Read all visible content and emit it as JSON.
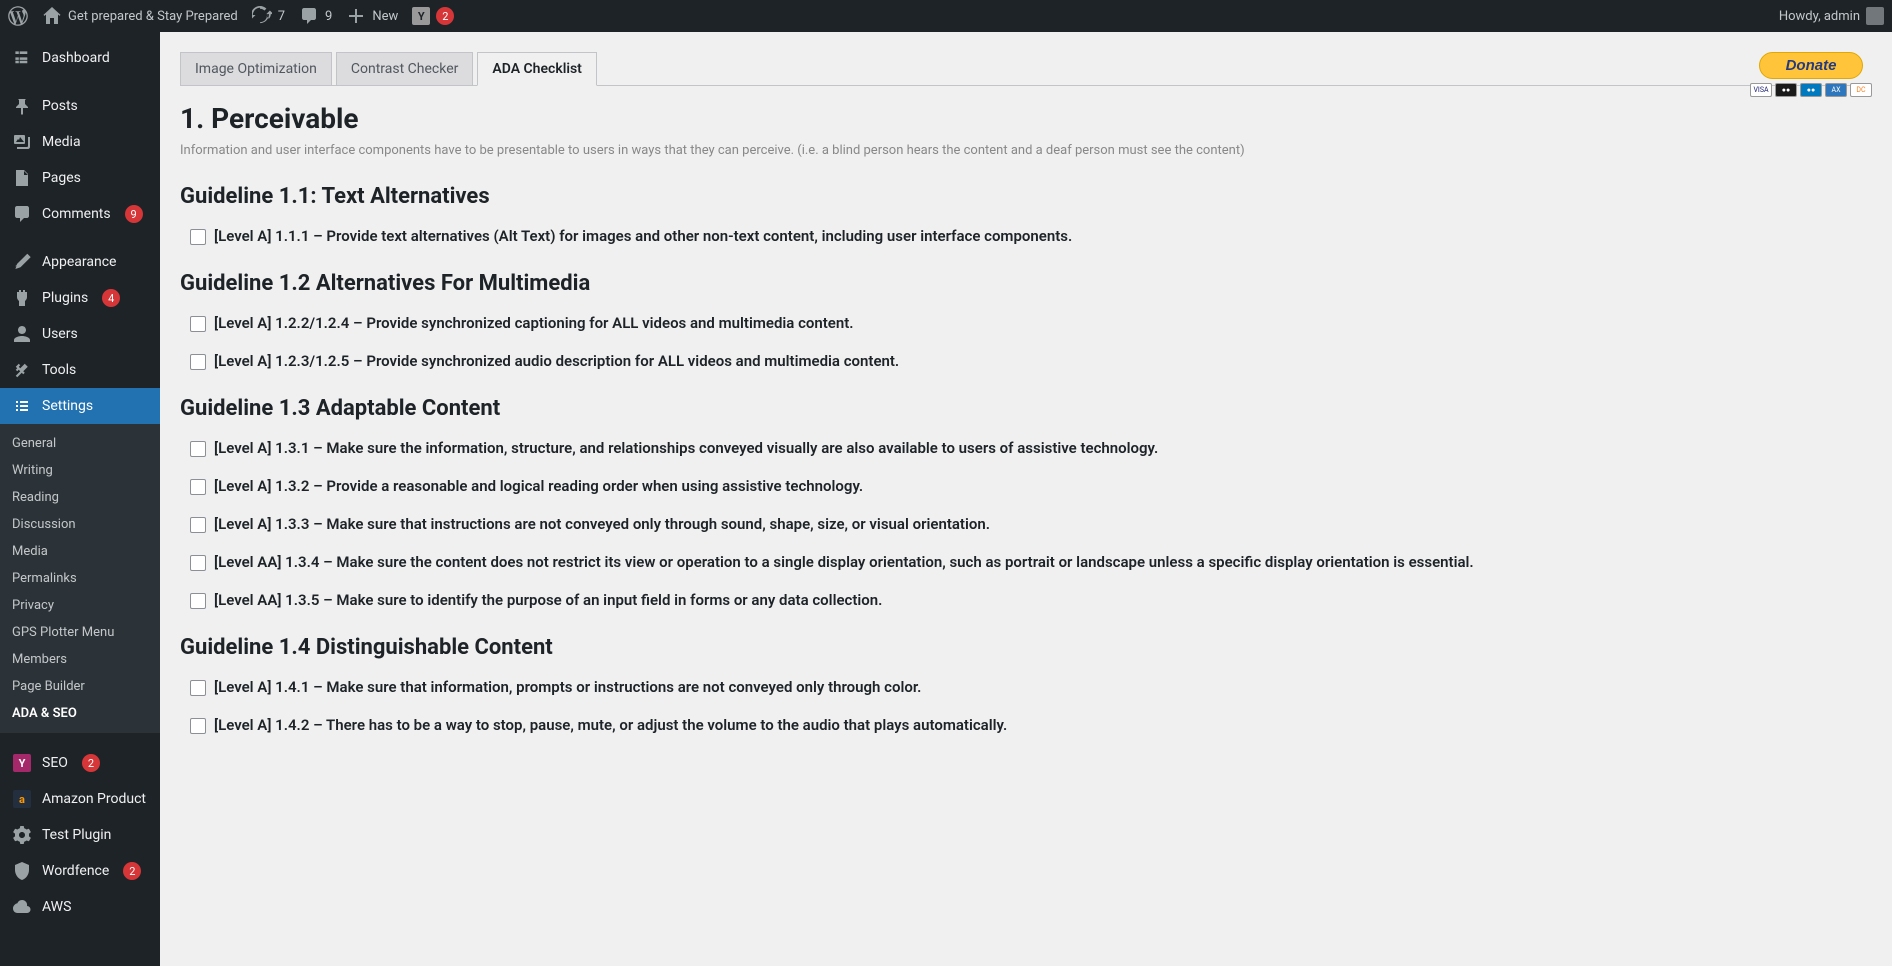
{
  "adminbar": {
    "site_name": "Get prepared & Stay Prepared",
    "updates": "7",
    "comments": "9",
    "new_label": "New",
    "yoast_badge": "2",
    "howdy": "Howdy, admin"
  },
  "sidebar": {
    "items": [
      {
        "label": "Dashboard",
        "icon": "dashboard"
      },
      {
        "label": "Posts",
        "icon": "pin"
      },
      {
        "label": "Media",
        "icon": "media"
      },
      {
        "label": "Pages",
        "icon": "page"
      },
      {
        "label": "Comments",
        "icon": "comment",
        "badge": "9"
      },
      {
        "label": "Appearance",
        "icon": "brush"
      },
      {
        "label": "Plugins",
        "icon": "plugin",
        "badge": "4"
      },
      {
        "label": "Users",
        "icon": "user"
      },
      {
        "label": "Tools",
        "icon": "tools"
      },
      {
        "label": "Settings",
        "icon": "settings",
        "current": true
      },
      {
        "label": "SEO",
        "icon": "yoast",
        "badge": "2"
      },
      {
        "label": "Amazon Product",
        "icon": "amazon"
      },
      {
        "label": "Test Plugin",
        "icon": "gear"
      },
      {
        "label": "Wordfence",
        "icon": "shield",
        "badge": "2"
      },
      {
        "label": "AWS",
        "icon": "cloud"
      }
    ],
    "submenu": [
      "General",
      "Writing",
      "Reading",
      "Discussion",
      "Media",
      "Permalinks",
      "Privacy",
      "GPS Plotter Menu",
      "Members",
      "Page Builder",
      "ADA & SEO"
    ],
    "submenu_current": "ADA & SEO"
  },
  "tabs": [
    "Image Optimization",
    "Contrast Checker",
    "ADA Checklist"
  ],
  "active_tab": "ADA Checklist",
  "donate": {
    "label": "Donate"
  },
  "content": {
    "h1": "1. Perceivable",
    "desc": "Information and user interface components have to be presentable to users in ways that they can perceive. (i.e. a blind person hears the content and a deaf person must see the content)",
    "sections": [
      {
        "title": "Guideline 1.1: Text Alternatives",
        "items": [
          "[Level A] 1.1.1 – Provide text alternatives (Alt Text) for images and other non-text content, including user interface components."
        ]
      },
      {
        "title": "Guideline 1.2 Alternatives For Multimedia",
        "items": [
          "[Level A] 1.2.2/1.2.4 – Provide synchronized captioning for ALL videos and multimedia content.",
          "[Level A] 1.2.3/1.2.5 – Provide synchronized audio description for ALL videos and multimedia content."
        ]
      },
      {
        "title": "Guideline 1.3 Adaptable Content",
        "items": [
          "[Level A] 1.3.1 – Make sure the information, structure, and relationships conveyed visually are also available to users of assistive technology.",
          "[Level A] 1.3.2 – Provide a reasonable and logical reading order when using assistive technology.",
          "[Level A] 1.3.3 – Make sure that instructions are not conveyed only through sound, shape, size, or visual orientation.",
          "[Level AA] 1.3.4 – Make sure the content does not restrict its view or operation to a single display orientation, such as portrait or landscape unless a specific display orientation is essential.",
          "[Level AA] 1.3.5 – Make sure to identify the purpose of an input field in forms or any data collection."
        ]
      },
      {
        "title": "Guideline 1.4 Distinguishable Content",
        "items": [
          "[Level A] 1.4.1 – Make sure that information, prompts or instructions are not conveyed only through color.",
          "[Level A] 1.4.2 – There has to be a way to stop, pause, mute, or adjust the volume to the audio that plays automatically."
        ]
      }
    ]
  }
}
